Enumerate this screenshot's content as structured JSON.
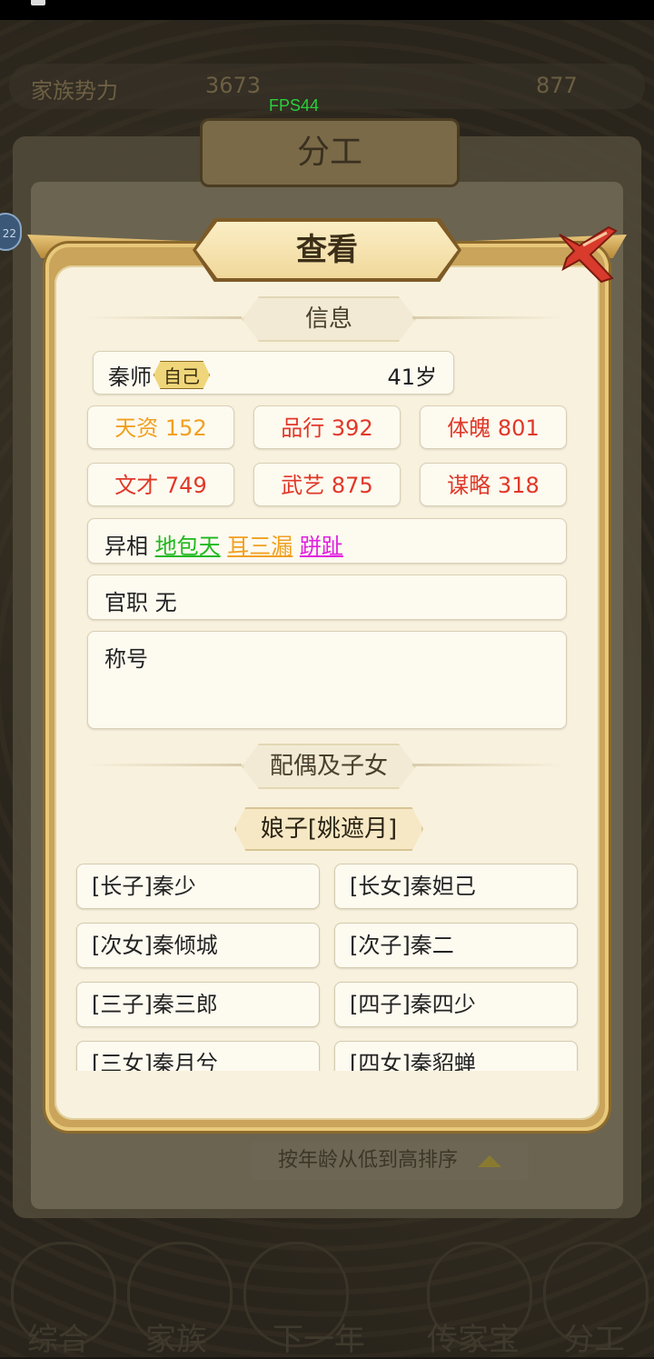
{
  "fps": "FPS44",
  "background": {
    "top_left_label": "家族势力",
    "top_mid_value": "3673",
    "top_right_value": "877",
    "panel_title": "分工",
    "sort_label": "按年龄从低到高排序",
    "nav": [
      "综合",
      "家族",
      "下一年",
      "传家宝",
      "分工"
    ]
  },
  "modal": {
    "title": "查看",
    "info_header": "信息",
    "name": "秦师",
    "self_tag": "自己",
    "age": "41岁",
    "stats": [
      {
        "label": "天资 152",
        "color": "#f0a020"
      },
      {
        "label": "品行 392",
        "color": "#e03828"
      },
      {
        "label": "体魄 801",
        "color": "#e03828"
      },
      {
        "label": "文才 749",
        "color": "#e03828"
      },
      {
        "label": "武艺 875",
        "color": "#e03828"
      },
      {
        "label": "谋略 318",
        "color": "#e03828"
      }
    ],
    "traits_label": "异相",
    "traits": [
      {
        "name": "地包天",
        "color": "#1fb81f"
      },
      {
        "name": "耳三漏",
        "color": "#f0a020"
      },
      {
        "name": "跰趾",
        "color": "#e020e0"
      }
    ],
    "office": "官职 无",
    "title_label": "称号",
    "family_header": "配偶及子女",
    "spouse": "娘子[姚遮月]",
    "children": [
      "[长子]秦少",
      "[长女]秦妲己",
      "[次女]秦倾城",
      "[次子]秦二",
      "[三子]秦三郎",
      "[四子]秦四少",
      "[三女]秦月兮",
      "[四女]秦貂蝉"
    ]
  }
}
